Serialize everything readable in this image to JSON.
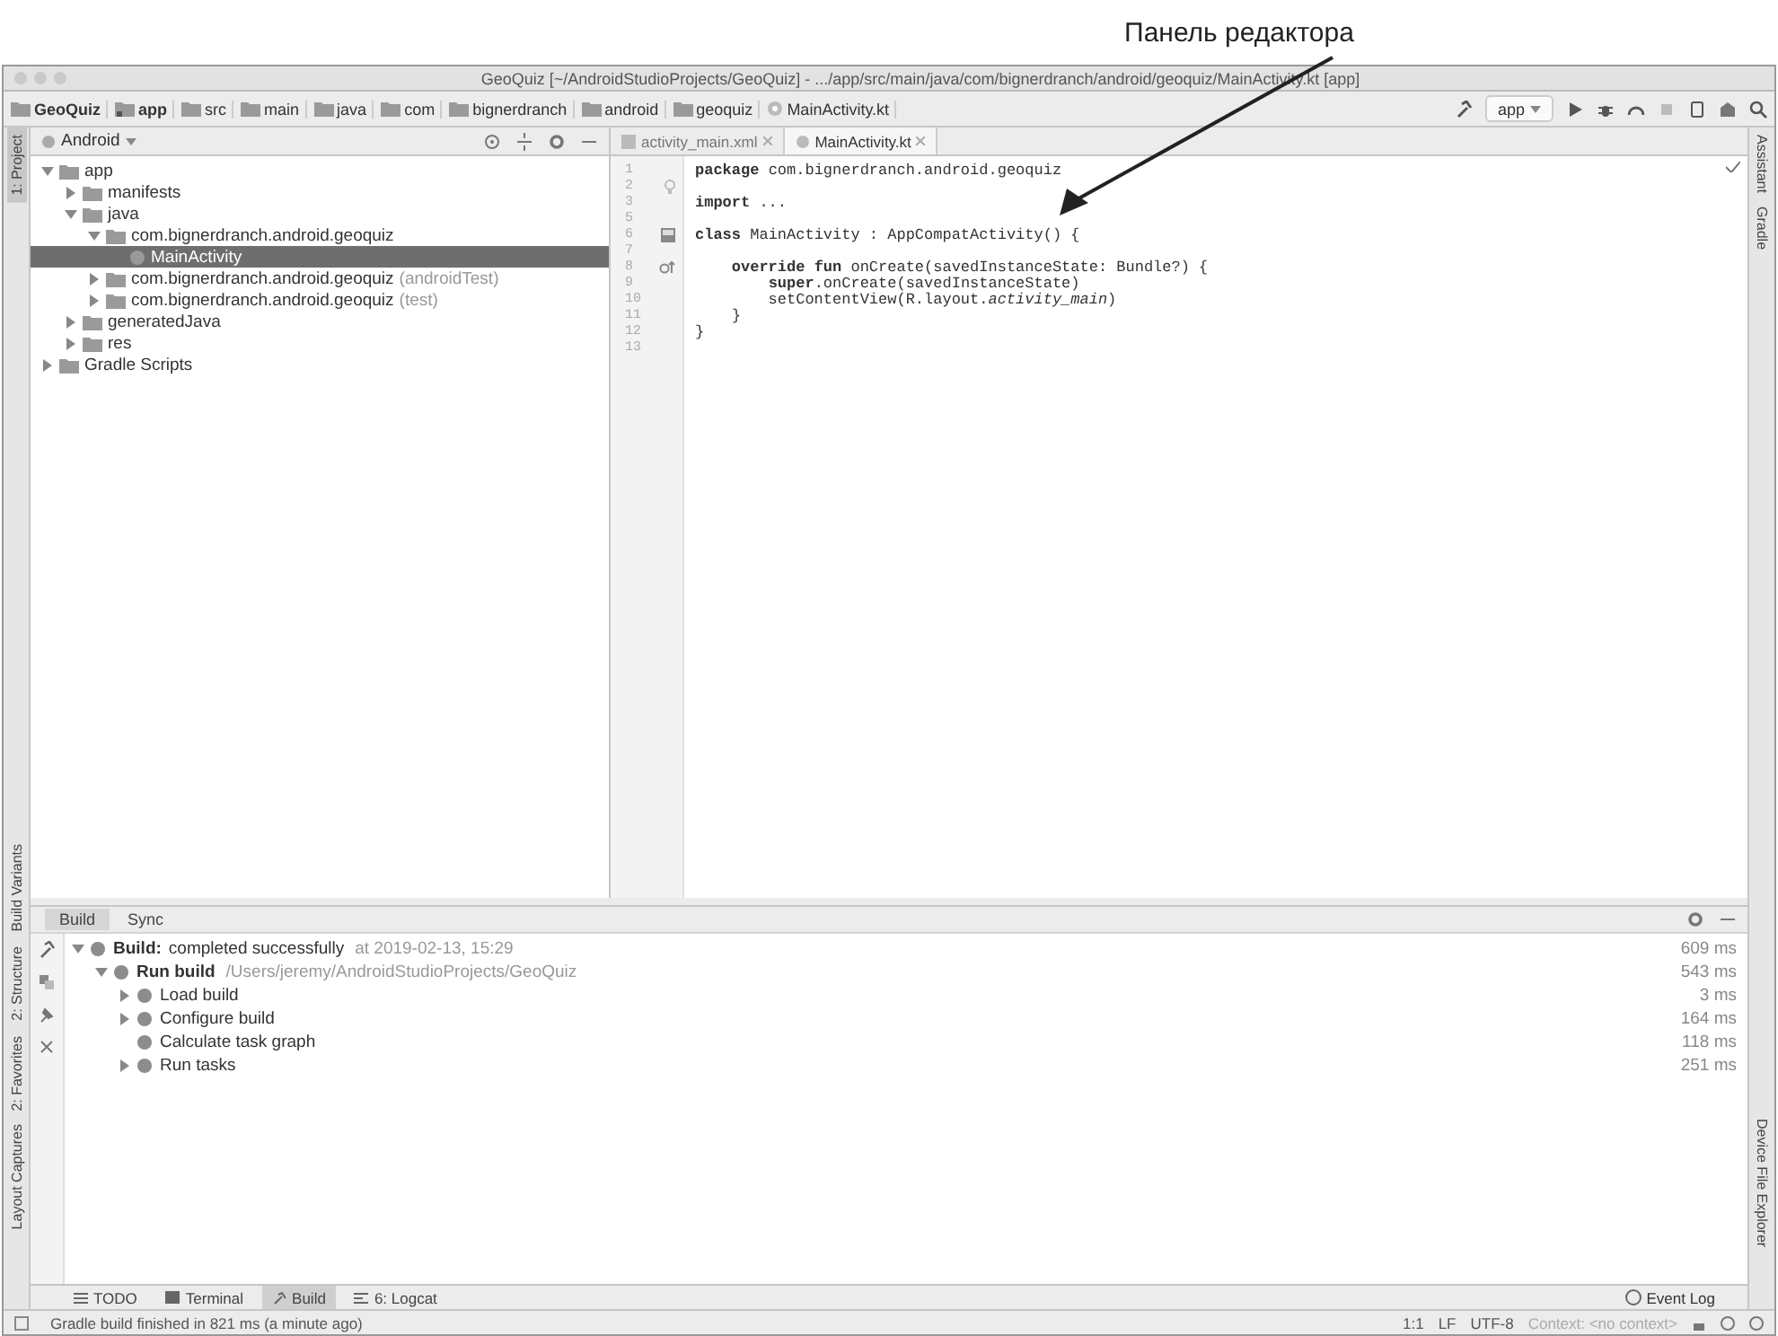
{
  "annotation": {
    "label": "Панель редактора"
  },
  "window": {
    "title": "GeoQuiz [~/AndroidStudioProjects/GeoQuiz] - .../app/src/main/java/com/bignerdranch/android/geoquiz/MainActivity.kt [app]"
  },
  "breadcrumbs": [
    {
      "label": "GeoQuiz",
      "kind": "folder"
    },
    {
      "label": "app",
      "kind": "module"
    },
    {
      "label": "src",
      "kind": "folder"
    },
    {
      "label": "main",
      "kind": "folder"
    },
    {
      "label": "java",
      "kind": "folder"
    },
    {
      "label": "com",
      "kind": "folder"
    },
    {
      "label": "bignerdranch",
      "kind": "folder"
    },
    {
      "label": "android",
      "kind": "folder"
    },
    {
      "label": "geoquiz",
      "kind": "folder"
    },
    {
      "label": "MainActivity.kt",
      "kind": "file"
    }
  ],
  "run_config": "app",
  "left_stripe": [
    {
      "label": "1: Project",
      "selected": true
    },
    {
      "label": "Build Variants",
      "selected": false
    },
    {
      "label": "2: Structure",
      "selected": false
    },
    {
      "label": "2: Favorites",
      "selected": false
    },
    {
      "label": "Layout Captures",
      "selected": false
    }
  ],
  "right_stripe": [
    {
      "label": "Assistant"
    },
    {
      "label": "Gradle"
    },
    {
      "label": "Device File Explorer"
    }
  ],
  "project": {
    "view": "Android",
    "tree": [
      {
        "label": "app",
        "expanded": true,
        "selected": false,
        "children": [
          {
            "label": "manifests",
            "expanded": false,
            "selected": false
          },
          {
            "label": "java",
            "expanded": true,
            "selected": false,
            "children": [
              {
                "label": "com.bignerdranch.android.geoquiz",
                "expanded": true,
                "selected": false,
                "children": [
                  {
                    "label": "MainActivity",
                    "selected": true
                  }
                ]
              },
              {
                "label": "com.bignerdranch.android.geoquiz",
                "suffix": "(androidTest)",
                "expanded": false,
                "selected": false
              },
              {
                "label": "com.bignerdranch.android.geoquiz",
                "suffix": "(test)",
                "expanded": false,
                "selected": false
              }
            ]
          },
          {
            "label": "generatedJava",
            "expanded": false,
            "selected": false
          },
          {
            "label": "res",
            "expanded": false,
            "selected": false
          }
        ]
      },
      {
        "label": "Gradle Scripts",
        "expanded": false,
        "selected": false
      }
    ]
  },
  "editor": {
    "tabs": [
      {
        "label": "activity_main.xml",
        "selected": false
      },
      {
        "label": "MainActivity.kt",
        "selected": true
      }
    ],
    "lines": [
      {
        "number": "1",
        "code": "**package** com.bignerdranch.android.geoquiz"
      },
      {
        "number": "2",
        "kind": "bulb"
      },
      {
        "number": "3",
        "code": "**import** ..."
      },
      {
        "number": "5"
      },
      {
        "number": "6",
        "code": "**class** MainActivity : AppCompatActivity() {",
        "kind": "layout"
      },
      {
        "number": "7"
      },
      {
        "number": "8",
        "code": "    **override fun** onCreate(savedInstanceState: Bundle?) {",
        "kind": "override"
      },
      {
        "number": "9",
        "code": "        **super**.onCreate(savedInstanceState)"
      },
      {
        "number": "10",
        "code": "        setContentView(R.layout.*activity_main*)"
      },
      {
        "number": "11",
        "code": "    }"
      },
      {
        "number": "12",
        "code": "}"
      },
      {
        "number": "13"
      }
    ]
  },
  "build": {
    "tabs": [
      {
        "label": "Build",
        "selected": true
      },
      {
        "label": "Sync",
        "selected": false
      }
    ],
    "tree": [
      {
        "label": "Build:",
        "text": "completed successfully",
        "note": "at 2019-02-13, 15:29",
        "time": "609 ms",
        "expanded": true,
        "children": [
          {
            "label": "Run build",
            "note": "/Users/jeremy/AndroidStudioProjects/GeoQuiz",
            "time": "543 ms",
            "expanded": true,
            "children": [
              {
                "text": "Load build",
                "time": "3 ms",
                "expanded": false
              },
              {
                "text": "Configure build",
                "time": "164 ms",
                "expanded": false
              },
              {
                "text": "Calculate task graph",
                "time": "118 ms"
              },
              {
                "text": "Run tasks",
                "time": "251 ms",
                "expanded": false
              }
            ]
          }
        ]
      }
    ]
  },
  "bottom_tabs": [
    {
      "label": "TODO",
      "kind": "todo",
      "selected": false
    },
    {
      "label": "Terminal",
      "kind": "terminal",
      "selected": false
    },
    {
      "label": "Build",
      "kind": "build",
      "selected": true
    },
    {
      "label": "6: Logcat",
      "kind": "logcat",
      "selected": false
    }
  ],
  "event_log": "Event Log",
  "status": {
    "message": "Gradle build finished in 821 ms (a minute ago)",
    "position": "1:1",
    "line_separator": "LF",
    "encoding": "UTF-8",
    "context": "Context: <no context>"
  }
}
